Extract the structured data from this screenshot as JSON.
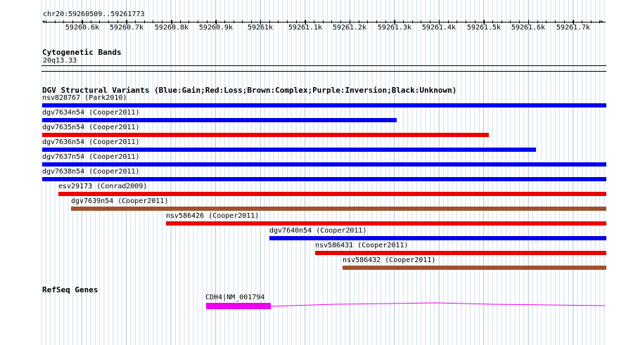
{
  "ruler": {
    "range_label": "chr20:59260509..59261773",
    "ticks": [
      "59260.6k",
      "59260.7k",
      "59260.8k",
      "59260.9k",
      "59261k",
      "59261.1k",
      "59261.2k",
      "59261.3k",
      "59261.4k",
      "59261.5k",
      "59261.6k",
      "59261.7k"
    ]
  },
  "cytoband": {
    "title": "Cytogenetic Bands",
    "band": "20q13.33"
  },
  "dgv": {
    "title": "DGV Structural Variants (Blue:Gain;Red:Loss;Brown:Complex;Purple:Inversion;Black:Unknown)",
    "colors": {
      "gain": "#0000ee",
      "loss": "#ee0000",
      "complex": "#a0522d"
    },
    "variants": [
      {
        "label": "nsv828767 (Park2010)",
        "type": "gain"
      },
      {
        "label": "dgv7634n54 (Cooper2011)",
        "type": "gain"
      },
      {
        "label": "dgv7635n54 (Cooper2011)",
        "type": "loss"
      },
      {
        "label": "dgv7636n54 (Cooper2011)",
        "type": "gain"
      },
      {
        "label": "dgv7637n54 (Cooper2011)",
        "type": "gain"
      },
      {
        "label": "dgv7638n54 (Cooper2011)",
        "type": "gain"
      },
      {
        "label": "esv29173 (Conrad2009)",
        "type": "loss"
      },
      {
        "label": "dgv7639n54 (Cooper2011)",
        "type": "complex"
      },
      {
        "label": "nsv586426 (Cooper2011)",
        "type": "loss"
      },
      {
        "label": "dgv7640n54 (Cooper2011)",
        "type": "gain"
      },
      {
        "label": "nsv586431 (Cooper2011)",
        "type": "loss"
      },
      {
        "label": "nsv586432 (Cooper2011)",
        "type": "complex"
      }
    ]
  },
  "refseq": {
    "title": "RefSeq Genes",
    "gene_label": "CDH4|NM_001794",
    "color": "#ee00ee"
  }
}
